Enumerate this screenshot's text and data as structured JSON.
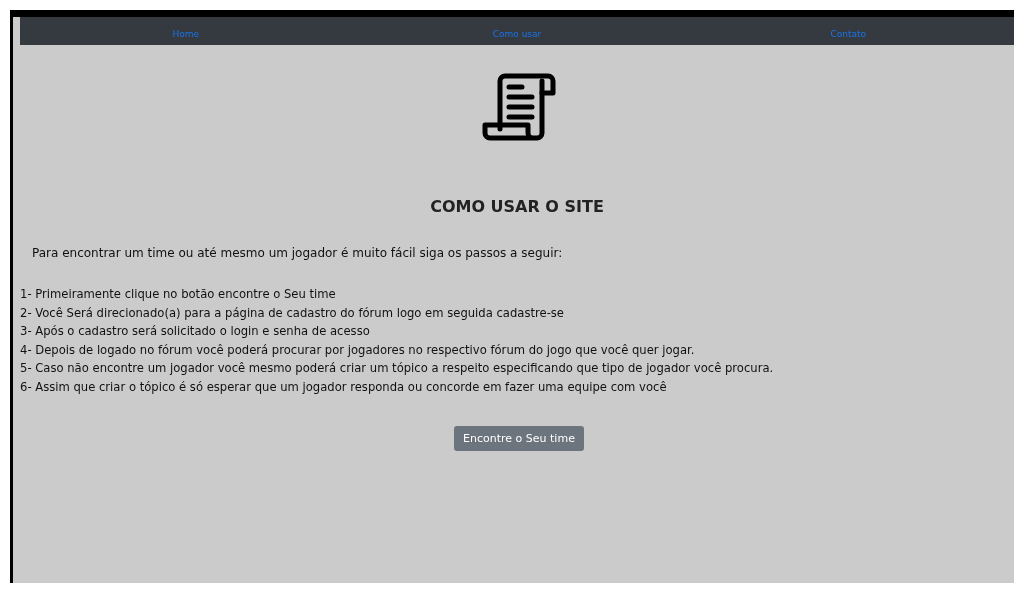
{
  "nav": {
    "links": [
      {
        "label": "Home"
      },
      {
        "label": "Como usar"
      },
      {
        "label": "Contato"
      }
    ]
  },
  "heading": "COMO USAR O SITE",
  "intro": "Para encontrar um time ou até mesmo um jogador é muito fácil siga os passos a seguir:",
  "steps": [
    "1- Primeiramente clique no botão encontre o Seu time",
    "2- Você Será direcionado(a) para a página de cadastro do fórum logo em seguida cadastre-se",
    "3- Após o cadastro será solicitado o login e senha de acesso",
    "4- Depois de logado no fórum você poderá procurar por jogadores no respectivo fórum do jogo que você quer jogar.",
    "5- Caso não encontre um jogador você mesmo poderá criar um tópico a respeito especificando que tipo de jogador você procura.",
    "6- Assim que criar o tópico é só esperar que um jogador responda ou concorde em fazer uma equipe com você"
  ],
  "button": "Encontre o Seu time"
}
